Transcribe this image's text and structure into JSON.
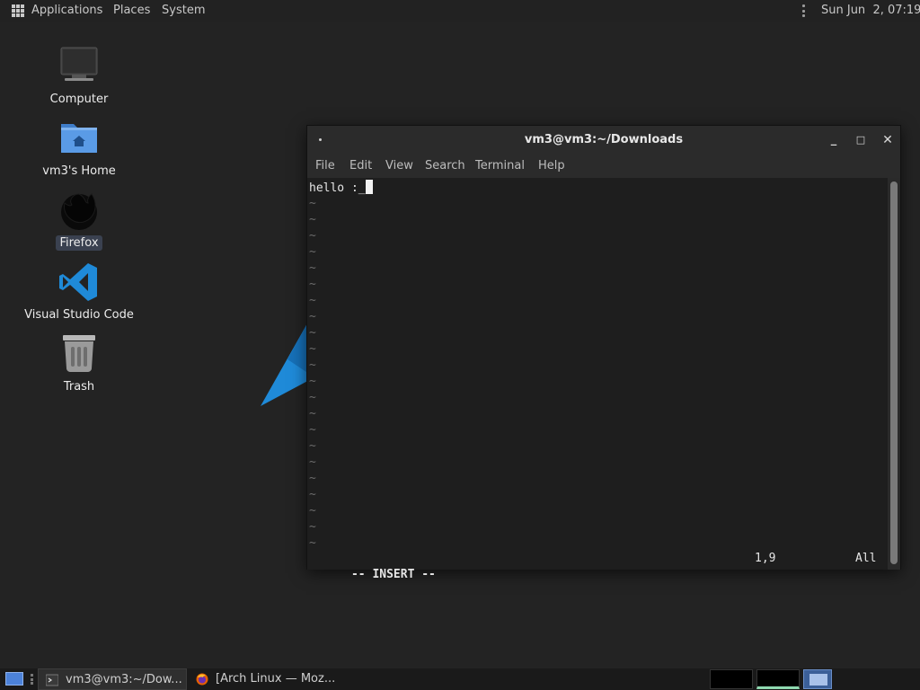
{
  "top_panel": {
    "menus": [
      "Applications",
      "Places",
      "System"
    ],
    "clock": "Sun Jun  2, 07:19",
    "icons": {
      "apps": "grid-icon",
      "tray": "tray-dots-icon"
    }
  },
  "desktop": {
    "icons": [
      {
        "label": "Computer",
        "icon": "computer-icon"
      },
      {
        "label": "vm3's Home",
        "icon": "home-folder-icon"
      },
      {
        "label": "Firefox",
        "icon": "firefox-icon",
        "selected": true
      },
      {
        "label": "Visual Studio Code",
        "icon": "vscode-icon"
      },
      {
        "label": "Trash",
        "icon": "trash-icon"
      }
    ]
  },
  "terminal": {
    "title": "vm3@vm3:~/Downloads",
    "menu": [
      "File",
      "Edit",
      "View",
      "Search",
      "Terminal",
      "Help"
    ],
    "first_line": "hello :_",
    "empty_line_marker": "~",
    "empty_line_count": 22,
    "status": {
      "mode": "-- INSERT --",
      "position": "1,9",
      "percent": "All"
    },
    "controls": {
      "minimize": "_",
      "maximize": "□",
      "close": "✕"
    }
  },
  "taskbar": {
    "tasks": [
      {
        "label": "vm3@vm3:~/Dow...",
        "icon": "terminal-icon",
        "active": true
      },
      {
        "label": "[Arch Linux — Moz...",
        "icon": "firefox-icon",
        "active": false
      }
    ],
    "workspaces": 3,
    "current_workspace": 2,
    "selected_workspace": 3
  },
  "colors": {
    "accent": "#4c82d9",
    "vscode_blue": "#1f8ad8",
    "desktop_bg": "#232323"
  }
}
